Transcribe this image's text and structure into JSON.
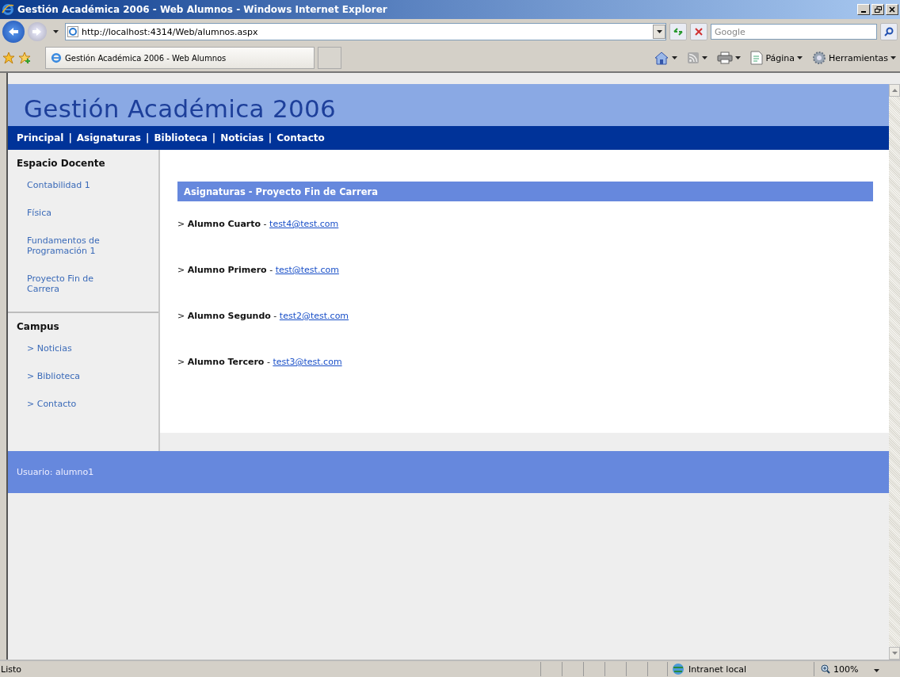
{
  "window": {
    "title": "Gestión Académica 2006 - Web Alumnos - Windows Internet Explorer"
  },
  "address_bar": {
    "url": "http://localhost:4314/Web/alumnos.aspx"
  },
  "search": {
    "placeholder": "Google"
  },
  "tab": {
    "title": "Gestión Académica 2006 - Web Alumnos"
  },
  "command_bar": [
    {
      "kind": "home"
    },
    {
      "kind": "feeds"
    },
    {
      "kind": "print"
    },
    {
      "kind": "page",
      "label": "Página"
    },
    {
      "kind": "tools",
      "label": "Herramientas"
    }
  ],
  "site": {
    "title": "Gestión Académica 2006",
    "nav": [
      {
        "label": "Principal"
      },
      {
        "label": "Asignaturas"
      },
      {
        "label": "Biblioteca"
      },
      {
        "label": "Noticias"
      },
      {
        "label": "Contacto"
      }
    ],
    "nav_separator": "|",
    "sidebar": [
      {
        "heading": "Espacio Docente",
        "items": [
          "Contabilidad 1",
          "Física",
          "Fundamentos de Programación 1",
          "Proyecto Fin de Carrera"
        ]
      },
      {
        "heading": "Campus",
        "items": [
          "> Noticias",
          "> Biblioteca",
          "> Contacto"
        ]
      }
    ],
    "section_title": "Asignaturas - Proyecto Fin de Carrera",
    "students": [
      {
        "text": "> **Alumno Cuarto** -",
        "email": "test4@test.com"
      },
      {
        "text": "> **Alumno Primero** -",
        "email": "test@test.com"
      },
      {
        "text": "> **Alumno Segundo** -",
        "email": "test2@test.com"
      },
      {
        "text": "> **Alumno Tercero** -",
        "email": "test3@test.com"
      }
    ],
    "user": "Usuario: alumno1"
  },
  "status_bar": {
    "text": "Listo",
    "zone": "Intranet local",
    "zoom": "100%"
  }
}
